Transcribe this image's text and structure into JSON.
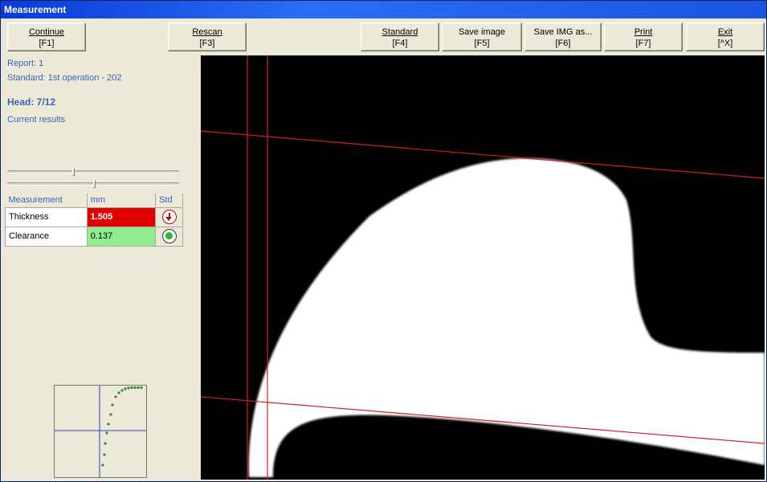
{
  "window": {
    "title": "Measurement"
  },
  "toolbar": {
    "continue": {
      "label": "Continue",
      "hotkey": "[F1]",
      "mnemonic": "C"
    },
    "rescan": {
      "label": "Rescan",
      "hotkey": "[F3]",
      "mnemonic": "R"
    },
    "standard": {
      "label": "Standard",
      "hotkey": "[F4]",
      "mnemonic": "S"
    },
    "save_image": {
      "label": "Save image",
      "hotkey": "[F5]",
      "mnemonic": "i"
    },
    "save_img_as": {
      "label": "Save IMG as...",
      "hotkey": "[F6]",
      "mnemonic": "a"
    },
    "print": {
      "label": "Print",
      "hotkey": "[F7]",
      "mnemonic": "P"
    },
    "exit": {
      "label": "Exit",
      "hotkey": "[^X]",
      "mnemonic": "E"
    }
  },
  "info": {
    "report": "Report: 1",
    "standard": "Standard: 1st operation - 202",
    "head": "Head: 7/12",
    "current_results": "Current results"
  },
  "sliders": {
    "upper_level": 0.38,
    "lower_level": 0.5
  },
  "table": {
    "headers": {
      "measurement": "Measurement",
      "unit": "mm",
      "std": "Std"
    },
    "rows": [
      {
        "name": "Thickness",
        "value": "1.505",
        "status": "out-of-tolerance",
        "indicator": "arrow-down-icon"
      },
      {
        "name": "Clearance",
        "value": "0.137",
        "status": "ok",
        "indicator": "green-dot-icon"
      }
    ]
  },
  "colors": {
    "bad": "#e00000",
    "ok": "#90ee90",
    "overlay_line": "#d02020",
    "info_text": "#3a64b4",
    "plot_points": "#2e8b2e",
    "plot_axes": "#2a3cc8"
  }
}
